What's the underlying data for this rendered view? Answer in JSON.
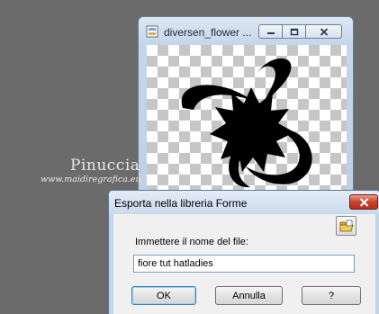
{
  "image_window": {
    "title": "diversen_flower ...",
    "controls": {
      "minimize": "minimize-icon",
      "maximize": "maximize-icon",
      "close": "close-icon"
    }
  },
  "watermark": {
    "name": "Pinuccia",
    "site": "www.maidiregrafica.eu"
  },
  "dialog": {
    "title": "Esporta nella libreria Forme",
    "prompt": "Immettere il nome del file:",
    "filename_value": "fiore tut hatladies",
    "ok_label": "OK",
    "cancel_label": "Annulla",
    "help_label": "?",
    "folder_icon": "folder-icon",
    "close_icon": "close-icon"
  },
  "colors": {
    "background": "#6b6b6b",
    "dialog_close": "#c9432c",
    "shape_fill": "#000000"
  }
}
